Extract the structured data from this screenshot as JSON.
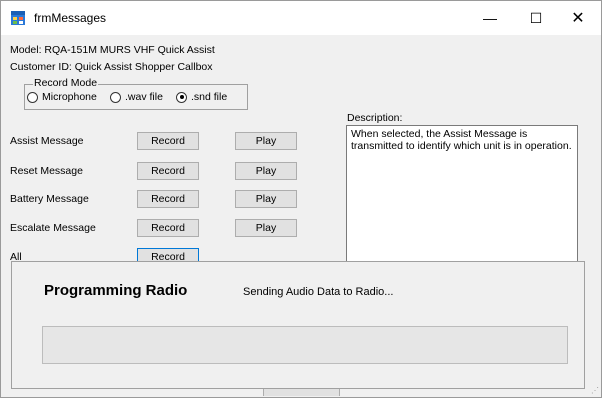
{
  "window": {
    "title": "frmMessages",
    "minimize": "—",
    "maximize": "☐",
    "close": "✕"
  },
  "info": {
    "model": "Model:  RQA-151M    MURS VHF Quick Assist",
    "customer": "Customer ID:  Quick Assist Shopper Callbox"
  },
  "record_mode": {
    "legend": "Record Mode",
    "options": [
      {
        "label": "Microphone",
        "checked": false
      },
      {
        "label": ".wav file",
        "checked": false
      },
      {
        "label": ".snd file",
        "checked": true
      }
    ]
  },
  "messages": [
    {
      "label": "Assist Message",
      "record": "Record",
      "play": "Play"
    },
    {
      "label": "Reset Message",
      "record": "Record",
      "play": "Play"
    },
    {
      "label": "Battery Message",
      "record": "Record",
      "play": "Play"
    },
    {
      "label": "Escalate Message",
      "record": "Record",
      "play": "Play"
    },
    {
      "label": "All",
      "record": "Record"
    }
  ],
  "description": {
    "label": "Description:",
    "text": "When selected, the Assist Message is transmitted to identify which unit is in operation."
  },
  "programming": {
    "title": "Programming Radio",
    "status": "Sending Audio Data to Radio...",
    "progress": 0
  },
  "colors": {
    "accent": "#0078d7",
    "progress": "#06b025"
  },
  "icons": {
    "app": "window-app-icon"
  }
}
